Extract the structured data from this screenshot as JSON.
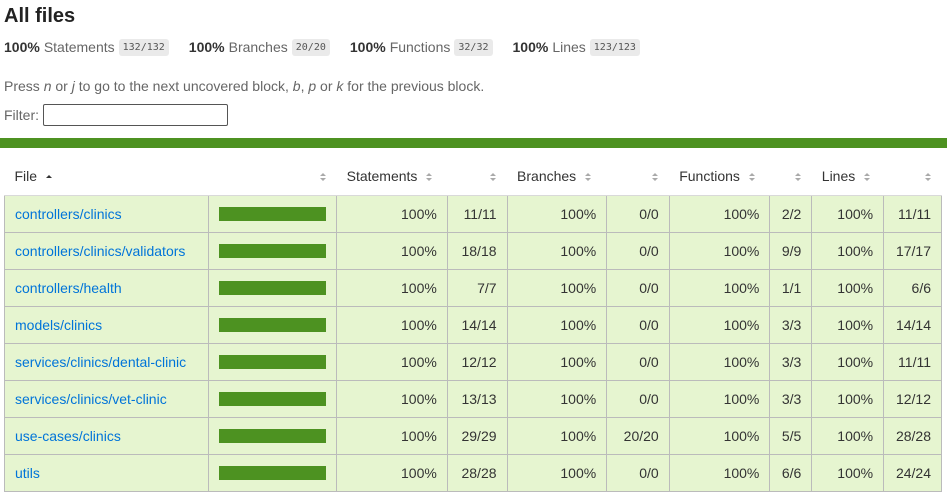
{
  "page": {
    "title": "All files",
    "summary": [
      {
        "pct": "100%",
        "label": "Statements",
        "frac": "132/132"
      },
      {
        "pct": "100%",
        "label": "Branches",
        "frac": "20/20"
      },
      {
        "pct": "100%",
        "label": "Functions",
        "frac": "32/32"
      },
      {
        "pct": "100%",
        "label": "Lines",
        "frac": "123/123"
      }
    ],
    "hint": {
      "p1": "Press ",
      "k1": "n",
      "p2": " or ",
      "k2": "j",
      "p3": " to go to the next uncovered block, ",
      "k3": "b",
      "p4": ", ",
      "k4": "p",
      "p5": " or ",
      "k5": "k",
      "p6": " for the previous block."
    },
    "filter_label": "Filter:",
    "filter_value": ""
  },
  "colors": {
    "high_bar": "#4d9221",
    "high_bg": "#e6f5d0",
    "link": "#0074d9"
  },
  "table": {
    "headers": {
      "file": "File",
      "statements": "Statements",
      "branches": "Branches",
      "functions": "Functions",
      "lines": "Lines"
    },
    "rows": [
      {
        "file": "controllers/clinics",
        "coverage": 1.0,
        "s_pct": "100%",
        "s_frac": "11/11",
        "b_pct": "100%",
        "b_frac": "0/0",
        "f_pct": "100%",
        "f_frac": "2/2",
        "l_pct": "100%",
        "l_frac": "11/11"
      },
      {
        "file": "controllers/clinics/validators",
        "coverage": 1.0,
        "s_pct": "100%",
        "s_frac": "18/18",
        "b_pct": "100%",
        "b_frac": "0/0",
        "f_pct": "100%",
        "f_frac": "9/9",
        "l_pct": "100%",
        "l_frac": "17/17"
      },
      {
        "file": "controllers/health",
        "coverage": 1.0,
        "s_pct": "100%",
        "s_frac": "7/7",
        "b_pct": "100%",
        "b_frac": "0/0",
        "f_pct": "100%",
        "f_frac": "1/1",
        "l_pct": "100%",
        "l_frac": "6/6"
      },
      {
        "file": "models/clinics",
        "coverage": 1.0,
        "s_pct": "100%",
        "s_frac": "14/14",
        "b_pct": "100%",
        "b_frac": "0/0",
        "f_pct": "100%",
        "f_frac": "3/3",
        "l_pct": "100%",
        "l_frac": "14/14"
      },
      {
        "file": "services/clinics/dental-clinic",
        "coverage": 1.0,
        "s_pct": "100%",
        "s_frac": "12/12",
        "b_pct": "100%",
        "b_frac": "0/0",
        "f_pct": "100%",
        "f_frac": "3/3",
        "l_pct": "100%",
        "l_frac": "11/11"
      },
      {
        "file": "services/clinics/vet-clinic",
        "coverage": 1.0,
        "s_pct": "100%",
        "s_frac": "13/13",
        "b_pct": "100%",
        "b_frac": "0/0",
        "f_pct": "100%",
        "f_frac": "3/3",
        "l_pct": "100%",
        "l_frac": "12/12"
      },
      {
        "file": "use-cases/clinics",
        "coverage": 1.0,
        "s_pct": "100%",
        "s_frac": "29/29",
        "b_pct": "100%",
        "b_frac": "20/20",
        "f_pct": "100%",
        "f_frac": "5/5",
        "l_pct": "100%",
        "l_frac": "28/28"
      },
      {
        "file": "utils",
        "coverage": 1.0,
        "s_pct": "100%",
        "s_frac": "28/28",
        "b_pct": "100%",
        "b_frac": "0/0",
        "f_pct": "100%",
        "f_frac": "6/6",
        "l_pct": "100%",
        "l_frac": "24/24"
      }
    ]
  }
}
